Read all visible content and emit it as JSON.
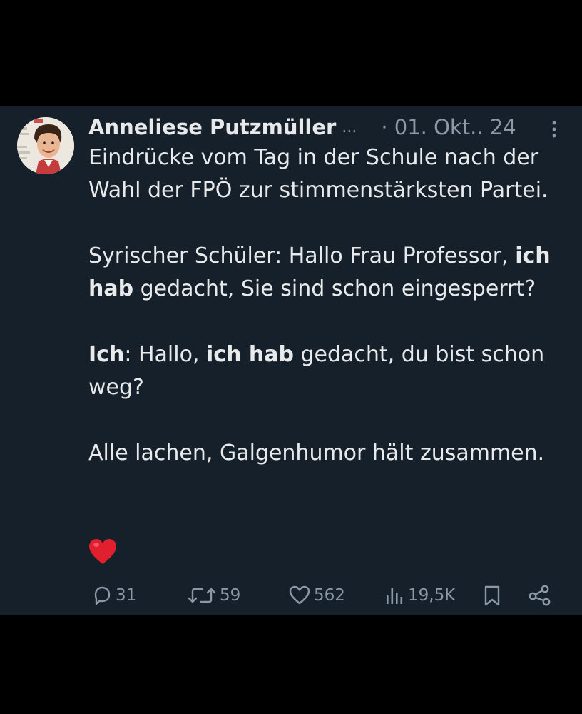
{
  "tweet": {
    "author": "Anneliese Putzmüller",
    "name_truncation": "...",
    "date": "· 01. Okt.. 24",
    "body": {
      "p1": "Eindrücke vom Tag in der Schule nach der Wahl der FPÖ zur stimmenstärksten Partei.",
      "p2_a": "Syrischer Schüler: Hallo Frau Professor, ",
      "p2_b": "ich hab",
      "p2_c": " gedacht, Sie sind schon eingesperrt?",
      "p3_a": "Ich",
      "p3_b": ": Hallo, ",
      "p3_c": "ich hab",
      "p3_d": " gedacht, du bist schon weg?",
      "p4": "Alle lachen, Galgenhumor hält zusammen."
    },
    "actions": {
      "replies": "31",
      "reposts": "59",
      "likes": "562",
      "views": "19,5K"
    }
  },
  "icons": {
    "avatar": "profile-photo",
    "more": "more-vertical-icon",
    "heart_emoji": "red-heart-emoji",
    "reply": "reply-icon",
    "repost": "repost-icon",
    "like": "like-icon",
    "views": "views-icon",
    "bookmark": "bookmark-icon",
    "share": "share-icon"
  },
  "colors": {
    "background": "#15202b",
    "text": "#e7e9ea",
    "secondary_text": "#8b98a5",
    "heart": "#e0202e"
  }
}
